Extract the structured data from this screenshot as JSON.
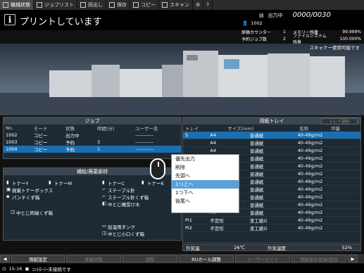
{
  "tabs": [
    {
      "label": "機械状態",
      "icon": "machine-icon",
      "active": true
    },
    {
      "label": "ジョブリスト",
      "icon": "list-icon",
      "active": false
    },
    {
      "label": "読出し",
      "icon": "folder-icon",
      "active": false
    },
    {
      "label": "保存",
      "icon": "save-icon",
      "active": false
    },
    {
      "label": "コピー",
      "icon": "copy-icon",
      "active": false
    },
    {
      "label": "スキャン",
      "icon": "scan-icon",
      "active": false
    }
  ],
  "header": {
    "title": "プリントしています",
    "status_label": "出力中",
    "status_count": "0000/0030",
    "user": "1002"
  },
  "counters": [
    {
      "label": "原稿カウンター",
      "value": "1",
      "label2": "メモリー残量",
      "value2": "99.999%"
    },
    {
      "label": "予約ジョブ数",
      "value": "2",
      "label2": "ファイルシステム残量",
      "value2": "100.000%"
    }
  ],
  "scanner_msg": "スキャナー使用可能です",
  "jobs": {
    "title": "ジョブ",
    "headers": [
      "No.",
      "モード",
      "状態",
      "時間(分)",
      "ユーザー名"
    ],
    "rows": [
      [
        "1002",
        "コピー",
        "出力中",
        "",
        "-----------"
      ],
      [
        "1003",
        "コピー",
        "予約",
        "3",
        "-----------"
      ],
      [
        "1004",
        "コピー",
        "予約",
        "1",
        "-----------"
      ]
    ],
    "selected": 2
  },
  "supplies": {
    "title": "補給/廃棄部材",
    "items": [
      "トナーY",
      "トナーM",
      "トナーC",
      "トナーK",
      "廃棄トナーボックス",
      "ステープル針",
      "パンチくず箱",
      "ステープル針くず箱",
      "中とじ機受け木",
      "中とじ両端くず箱",
      "加湿用タンク",
      "中とじ小口くず箱"
    ]
  },
  "paper": {
    "title": "用紙トレイ",
    "tray_button": "トレイ選択",
    "headers": [
      "トレイ",
      "サイズ(mm)",
      "名称",
      "坪量"
    ],
    "rows": [
      [
        "S",
        "A4",
        "普通紙",
        "40-49g/m2"
      ],
      [
        "",
        "A4",
        "普通紙",
        "40-49g/m2"
      ],
      [
        "",
        "A4",
        "普通紙",
        "40-49g/m2"
      ],
      [
        "",
        "A4",
        "普通紙",
        "40-49g/m2"
      ],
      [
        "",
        "A4",
        "普通紙",
        "40-49g/m2"
      ],
      [
        "",
        "A4",
        "普通紙",
        "40-49g/m2"
      ],
      [
        "",
        "A4",
        "普通紙",
        "40-49g/m2"
      ],
      [
        "",
        "A4",
        "普通紙",
        "40-49g/m2"
      ],
      [
        "",
        "A4",
        "普通紙",
        "40-49g/m2"
      ],
      [
        "",
        "A4",
        "普通紙",
        "40-49g/m2"
      ],
      [
        "",
        "A4",
        "普通紙",
        "40-49g/m2"
      ],
      [
        "PI1",
        "不定形",
        "塗工紙G",
        "40-49g/m2"
      ],
      [
        "PI2",
        "不定形",
        "塗工紙G",
        "40-49g/m2"
      ]
    ],
    "selected": 0,
    "outside_temp_label": "外気温",
    "outside_temp": "26℃",
    "humidity_label": "外気湿度",
    "humidity": "52%"
  },
  "context_menu": [
    "優先出力",
    "削除",
    "先頭へ",
    "1つ上へ",
    "1つ下へ",
    "後尾へ"
  ],
  "context_highlight": 3,
  "bottom": [
    "用紙設定",
    "表裏調整",
    "調整",
    "RUカール調整",
    "ユーザーガイド",
    "用紙条件登録/削除"
  ],
  "footer": {
    "time": "15:16",
    "msg": "ｺﾝﾄﾛｰﾗｰ未接続です"
  }
}
